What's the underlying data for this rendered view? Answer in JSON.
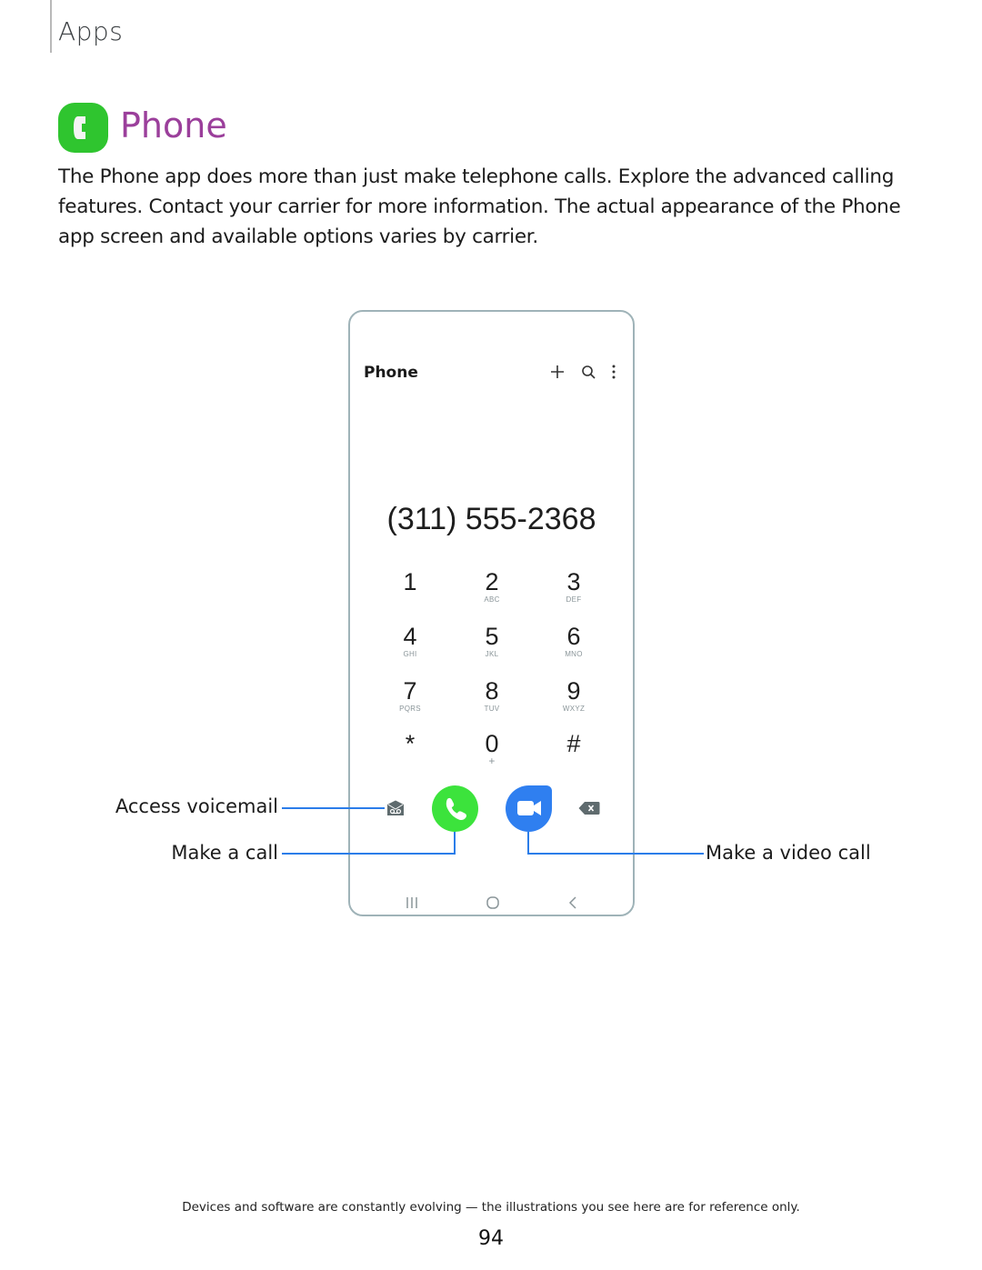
{
  "section": {
    "label": "Apps"
  },
  "header": {
    "title": "Phone",
    "icon": "phone-app-icon",
    "title_color": "#9b3f9b",
    "icon_color": "#2fc52f"
  },
  "intro": "The Phone app does more than just make telephone calls. Explore the advanced calling features. Contact your carrier for more information. The actual appearance of the Phone app screen and available options varies by carrier.",
  "device": {
    "app_title": "Phone",
    "toolbar_icons": [
      "plus-icon",
      "search-icon",
      "more-options-icon"
    ],
    "dialed_number": "(311) 555-2368",
    "keypad": [
      {
        "digit": "1",
        "letters": ""
      },
      {
        "digit": "2",
        "letters": "ABC"
      },
      {
        "digit": "3",
        "letters": "DEF"
      },
      {
        "digit": "4",
        "letters": "GHI"
      },
      {
        "digit": "5",
        "letters": "JKL"
      },
      {
        "digit": "6",
        "letters": "MNO"
      },
      {
        "digit": "7",
        "letters": "PQRS"
      },
      {
        "digit": "8",
        "letters": "TUV"
      },
      {
        "digit": "9",
        "letters": "WXYZ"
      },
      {
        "digit": "*",
        "letters": ""
      },
      {
        "digit": "0",
        "letters": "+"
      },
      {
        "digit": "#",
        "letters": ""
      }
    ],
    "actions": [
      "voicemail-icon",
      "call-button",
      "video-call-button",
      "backspace-icon"
    ],
    "nav_bar": [
      "recent-apps-icon",
      "home-icon",
      "back-icon"
    ],
    "colors": {
      "call": "#3ce33c",
      "video": "#2f7ff0",
      "callout_line": "#2b7de9"
    }
  },
  "callouts": {
    "voicemail": "Access voicemail",
    "call": "Make a call",
    "video": "Make a video call"
  },
  "footer": {
    "note": "Devices and software are constantly evolving — the illustrations you see here are for reference only.",
    "page_number": "94"
  }
}
